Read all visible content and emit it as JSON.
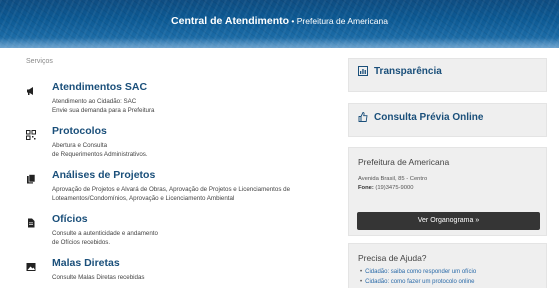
{
  "header": {
    "title_bold": "Central de Atendimento",
    "separator": " • ",
    "title_sub": "Prefeitura de Americana"
  },
  "services_label": "Serviços",
  "services": [
    {
      "name": "Atendimentos SAC",
      "icon": "megaphone-icon",
      "desc": [
        "Atendimento ao Cidadão: SAC",
        "Envie sua demanda para a Prefeitura"
      ]
    },
    {
      "name": "Protocolos",
      "icon": "qrcode-icon",
      "desc": [
        "Abertura e Consulta",
        "de Requerimentos Administrativos."
      ]
    },
    {
      "name": "Análises de Projetos",
      "icon": "documents-icon",
      "desc": [
        "Aprovação de Projetos e Alvará de Obras, Aprovação de Projetos e Licenciamentos de",
        "Loteamentos/Condomínios, Aprovação e Licenciamento Ambiental"
      ]
    },
    {
      "name": "Ofícios",
      "icon": "file-icon",
      "desc": [
        "Consulte a autenticidade e andamento",
        "de Ofícios recebidos."
      ]
    },
    {
      "name": "Malas Diretas",
      "icon": "picture-icon",
      "desc": [
        "Consulte Malas Diretas recebidas"
      ]
    }
  ],
  "sidebar": {
    "transparencia": "Transparência",
    "consulta": "Consulta Prévia Online",
    "info": {
      "title": "Prefeitura de Americana",
      "address": "Avenida Brasil, 85 - Centro",
      "phone_label": "Fone:",
      "phone": " (19)3475-9000",
      "button": "Ver Organograma »"
    },
    "help": {
      "title": "Precisa de Ajuda?",
      "items": [
        "Cidadão: saiba como responder um ofício",
        "Cidadão: como fazer um protocolo online"
      ]
    }
  }
}
